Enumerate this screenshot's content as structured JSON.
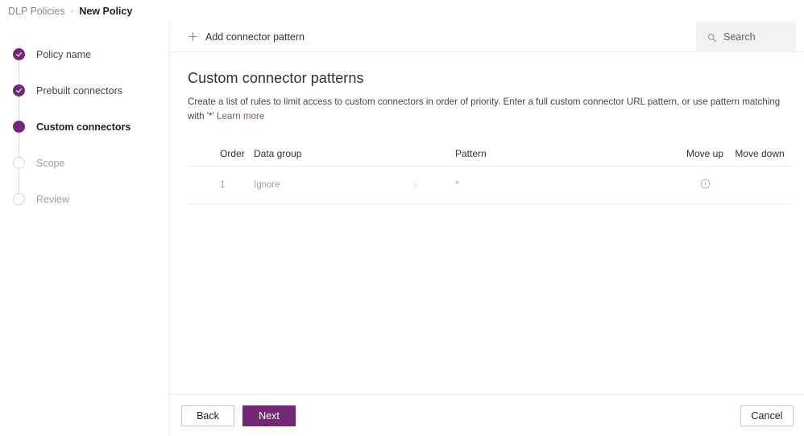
{
  "breadcrumb": {
    "parent": "DLP Policies",
    "separator": "›",
    "current": "New Policy"
  },
  "wizard": {
    "steps": [
      {
        "label": "Policy name",
        "state": "done"
      },
      {
        "label": "Prebuilt connectors",
        "state": "done"
      },
      {
        "label": "Custom connectors",
        "state": "current"
      },
      {
        "label": "Scope",
        "state": "todo"
      },
      {
        "label": "Review",
        "state": "todo"
      }
    ]
  },
  "commandbar": {
    "add_label": "Add connector pattern",
    "add_icon": "plus-icon"
  },
  "search": {
    "placeholder": "Search",
    "icon": "search-icon"
  },
  "main": {
    "title": "Custom connector patterns",
    "description_prefix": "Create a list of rules to limit access to custom connectors in order of priority. Enter a full custom connector URL pattern, or use pattern matching with '*' ",
    "description_link": "Learn more"
  },
  "table": {
    "columns": {
      "order": "Order",
      "data_group": "Data group",
      "pattern": "Pattern",
      "move_up": "Move up",
      "move_down": "Move down"
    },
    "rows": [
      {
        "order": "1",
        "data_group": "Ignore",
        "group_menu_icon": "kebab-menu-icon",
        "pattern": "*",
        "move_up_icon": "info-icon",
        "move_down": ""
      }
    ]
  },
  "footer": {
    "back_label": "Back",
    "next_label": "Next",
    "cancel_label": "Cancel"
  },
  "colors": {
    "accent": "#742774",
    "step_todo_border": "#d8d4dd",
    "connector_line": "#ddd8e2",
    "search_bg": "#f3f2f1",
    "link": "#7a5a82",
    "info_icon": "#b59cbd"
  }
}
